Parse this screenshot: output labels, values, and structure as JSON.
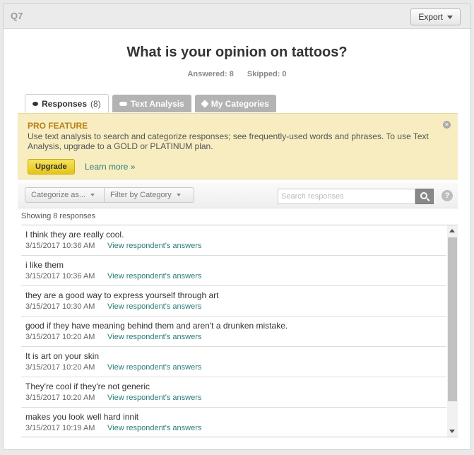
{
  "header": {
    "question_label": "Q7",
    "export_label": "Export"
  },
  "question": {
    "title": "What is your opinion on tattoos?",
    "answered": "Answered: 8",
    "skipped": "Skipped: 0"
  },
  "tabs": [
    {
      "label": "Responses",
      "count": "(8)",
      "icon": "bubble-icon",
      "active": true
    },
    {
      "label": "Text Analysis",
      "icon": "cloud-icon",
      "active": false
    },
    {
      "label": "My Categories",
      "icon": "tag-icon",
      "active": false
    }
  ],
  "promo": {
    "title": "PRO FEATURE",
    "text": "Use text analysis to search and categorize responses; see frequently-used words and phrases. To use Text Analysis, upgrade to a GOLD or PLATINUM plan.",
    "upgrade_label": "Upgrade",
    "learn_more": "Learn more »",
    "accent": "#f8edc1"
  },
  "toolbar": {
    "categorize_label": "Categorize as...",
    "filter_label": "Filter by Category",
    "search_placeholder": "Search responses",
    "help": "?"
  },
  "showing": "Showing 8 responses",
  "link_color": "#287b78",
  "responses": [
    {
      "text": "I think they are really cool.",
      "date": "3/15/2017 10:36 AM",
      "link": "View respondent's answers"
    },
    {
      "text": "i like them",
      "date": "3/15/2017 10:36 AM",
      "link": "View respondent's answers"
    },
    {
      "text": "they are a good way to express yourself through art",
      "date": "3/15/2017 10:30 AM",
      "link": "View respondent's answers"
    },
    {
      "text": "good if they have meaning behind them and aren't a drunken mistake.",
      "date": "3/15/2017 10:20 AM",
      "link": "View respondent's answers"
    },
    {
      "text": "It is art on your skin",
      "date": "3/15/2017 10:20 AM",
      "link": "View respondent's answers"
    },
    {
      "text": "They're cool if they're not generic",
      "date": "3/15/2017 10:20 AM",
      "link": "View respondent's answers"
    },
    {
      "text": "makes you look well hard innit",
      "date": "3/15/2017 10:19 AM",
      "link": "View respondent's answers"
    }
  ]
}
